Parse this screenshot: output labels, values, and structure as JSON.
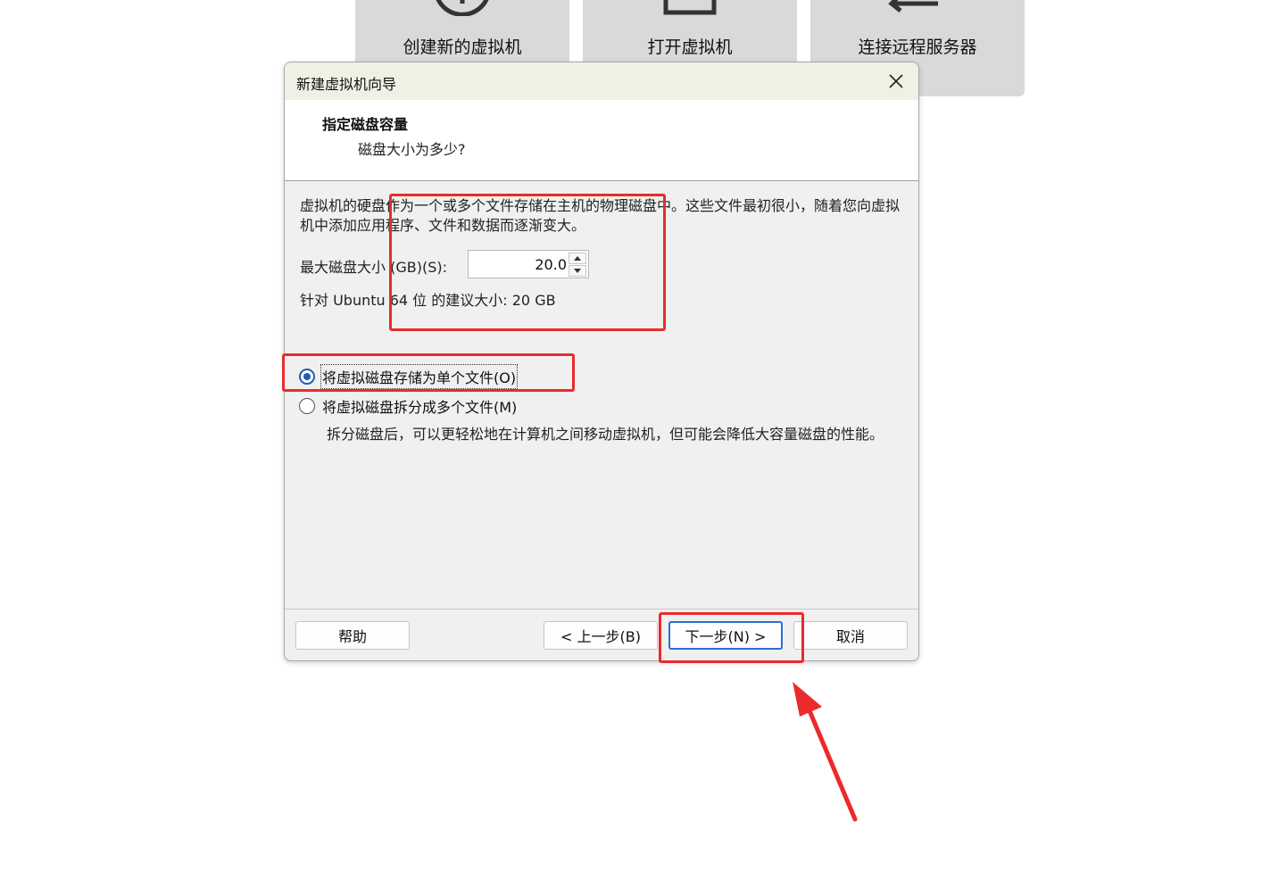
{
  "tiles": [
    {
      "label": "创建新的虚拟机",
      "icon": "plus-circle-icon"
    },
    {
      "label": "打开虚拟机",
      "icon": "folder-icon"
    },
    {
      "label": "连接远程服务器",
      "icon": "arrow-left-icon"
    }
  ],
  "dialog": {
    "title": "新建虚拟机向导",
    "header": {
      "title": "指定磁盘容量",
      "subtitle": "磁盘大小为多少?"
    },
    "description": "虚拟机的硬盘作为一个或多个文件存储在主机的物理磁盘中。这些文件最初很小，随着您向虚拟机中添加应用程序、文件和数据而逐渐变大。",
    "max_size_label": "最大磁盘大小 (GB)(S):",
    "max_size_value": "20.0",
    "recommend_text": "针对 Ubuntu 64 位 的建议大小: 20 GB",
    "options": {
      "single_file": "将虚拟磁盘存储为单个文件(O)",
      "split_files": "将虚拟磁盘拆分成多个文件(M)",
      "selected": "single_file"
    },
    "split_description": "拆分磁盘后，可以更轻松地在计算机之间移动虚拟机，但可能会降低大容量磁盘的性能。",
    "buttons": {
      "help": "帮助",
      "back": "< 上一步(B)",
      "next": "下一步(N) >",
      "cancel": "取消"
    }
  },
  "colors": {
    "annotation_red": "#ea2b2b",
    "accent_blue": "#1a5fb4",
    "tile_gray": "#d9d9d9"
  }
}
